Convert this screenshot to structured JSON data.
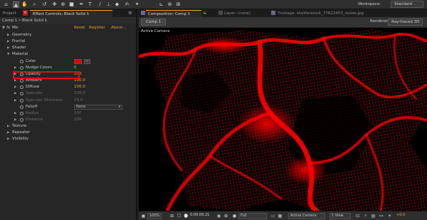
{
  "toolbar": {
    "workspace_label": "Workspace:",
    "workspace_value": "Standard",
    "tools": [
      {
        "name": "home-tool-icon",
        "glyph": "⌂"
      },
      {
        "name": "selection-tool-icon",
        "glyph": "▲"
      },
      {
        "name": "hand-tool-icon",
        "glyph": "✋"
      },
      {
        "name": "zoom-tool-icon",
        "glyph": "⌕"
      },
      {
        "name": "rotate-tool-icon",
        "glyph": "↺"
      },
      {
        "name": "camera-tool-icon",
        "glyph": "✥"
      },
      {
        "name": "pan-behind-tool-icon",
        "glyph": "⊕"
      },
      {
        "name": "rectangle-tool-icon",
        "glyph": "■"
      },
      {
        "name": "pen-tool-icon",
        "glyph": "✒"
      },
      {
        "name": "type-tool-icon",
        "glyph": "T"
      },
      {
        "name": "brush-tool-icon",
        "glyph": "∕"
      },
      {
        "name": "clone-tool-icon",
        "glyph": "⊥"
      },
      {
        "name": "eraser-tool-icon",
        "glyph": "◆"
      },
      {
        "name": "roto-tool-icon",
        "glyph": "✍"
      },
      {
        "name": "puppet-tool-icon",
        "glyph": "✶"
      },
      {
        "name": "axis-local-icon",
        "glyph": "⊾"
      },
      {
        "name": "axis-world-icon",
        "glyph": "⊗"
      },
      {
        "name": "axis-view-icon",
        "glyph": "⊞"
      }
    ]
  },
  "left_panel": {
    "tabs": {
      "project": "Project",
      "effect_controls": "Effect Controls: Black Solid 1"
    },
    "layer_path": "Comp 1 • Black Solid 1",
    "effect": {
      "icon": "fx",
      "name": "Mir",
      "reset": "Reset",
      "register": "Register",
      "about": "About..."
    },
    "properties": [
      {
        "label": "Geometry",
        "value": "",
        "level": 0,
        "kind": "group",
        "dim": false
      },
      {
        "label": "Fractal",
        "value": "",
        "level": 0,
        "kind": "group",
        "dim": false
      },
      {
        "label": "Shader",
        "value": "",
        "level": 0,
        "kind": "group",
        "dim": false
      },
      {
        "label": "Material",
        "value": "",
        "level": 0,
        "kind": "group-open",
        "dim": false
      },
      {
        "label": "Color",
        "value": "",
        "level": 1,
        "kind": "color",
        "dim": false
      },
      {
        "label": "Nudge Colors",
        "value": "0",
        "level": 1,
        "kind": "value-tri",
        "dim": false
      },
      {
        "label": "Opacity",
        "value": "100",
        "level": 1,
        "kind": "value-tri",
        "dim": false
      },
      {
        "label": "Ambient",
        "value": "100.0",
        "level": 1,
        "kind": "value-tri",
        "dim": false
      },
      {
        "label": "Diffuse",
        "value": "100.0",
        "level": 1,
        "kind": "value-tri",
        "dim": false
      },
      {
        "label": "Specular",
        "value": "100.0",
        "level": 1,
        "kind": "value-tri",
        "dim": true
      },
      {
        "label": "Specular Shininess",
        "value": "15.0",
        "level": 1,
        "kind": "value-tri",
        "dim": true
      },
      {
        "label": "Falloff",
        "value": "None",
        "level": 1,
        "kind": "dropdown",
        "dim": false
      },
      {
        "label": "Radius",
        "value": "100",
        "level": 1,
        "kind": "value-tri",
        "dim": true
      },
      {
        "label": "Distance",
        "value": "100",
        "level": 1,
        "kind": "value-tri",
        "dim": true
      },
      {
        "label": "Texture",
        "value": "",
        "level": 0,
        "kind": "group",
        "dim": false
      },
      {
        "label": "Repeater",
        "value": "",
        "level": 0,
        "kind": "group",
        "dim": false
      },
      {
        "label": "Visibility",
        "value": "",
        "level": 0,
        "kind": "group",
        "dim": false
      }
    ],
    "colors": {
      "material_color": "#e60000",
      "highlight": "#e01010",
      "accent": "#e6a72c"
    }
  },
  "right_panel": {
    "tabs": {
      "composition": "Composition: Comp 1",
      "layer": "Layer: (none)",
      "footage": "Footage: shutterstock_77622403_resize.jpg"
    },
    "comp_button": "Comp 1",
    "renderer_label": "Renderer:",
    "renderer_value": "Ray-traced 3D",
    "camera_label": "Active Camera",
    "viewer_color": "#ff0000",
    "bottom": {
      "zoom": "100%",
      "timecode": "0:00:00:21",
      "resolution": "Full",
      "camera": "Active Camera",
      "views": "1 View",
      "exposure": "+0.0"
    }
  }
}
